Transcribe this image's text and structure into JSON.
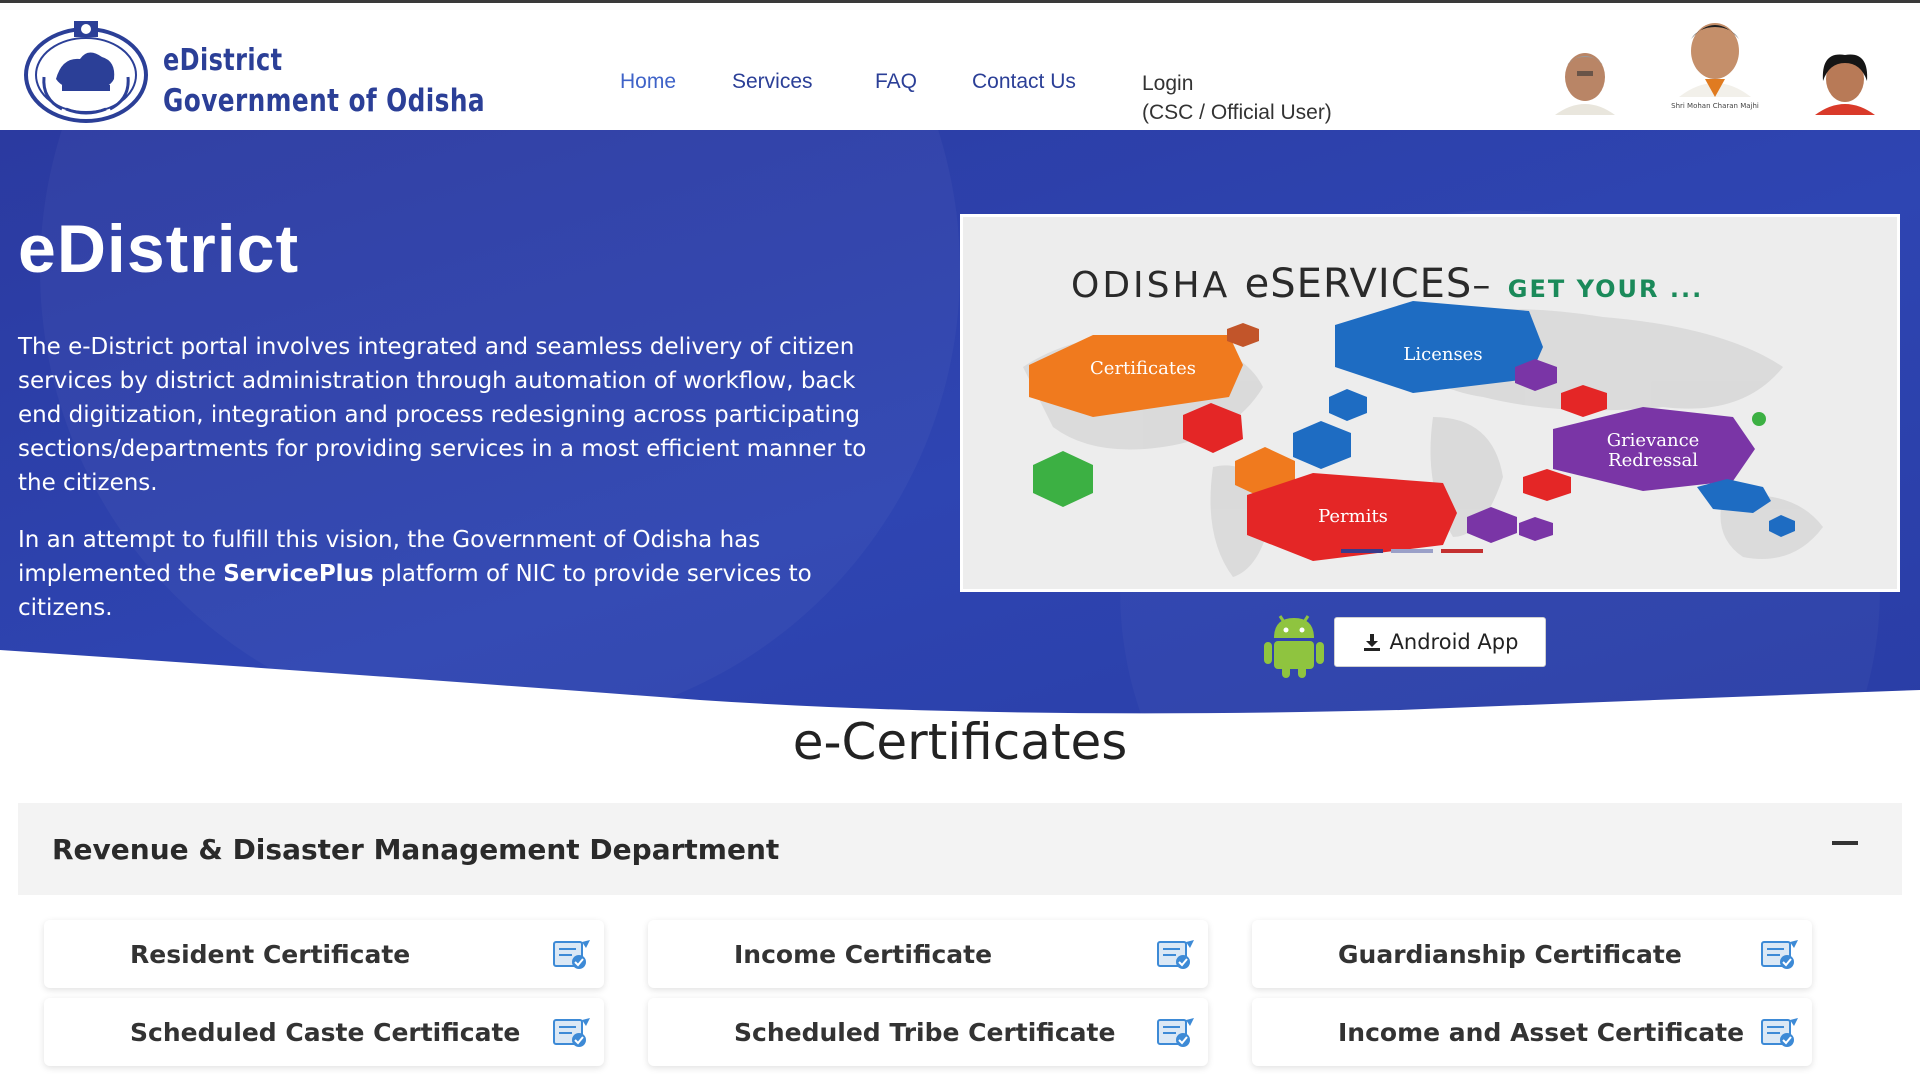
{
  "header": {
    "brand_line1": "eDistrict",
    "brand_line2": "Government of Odisha",
    "nav": {
      "home": "Home",
      "services": "Services",
      "faq": "FAQ",
      "contact": "Contact Us",
      "login_line1": "Login",
      "login_line2": "(CSC / Official User)"
    },
    "leaders": {
      "center_caption": "Shri Mohan Charan Majhi"
    }
  },
  "hero": {
    "title": "eDistrict",
    "paragraph1": "The e-District portal involves integrated and seamless delivery of citizen services by district administration through automation of workflow, back end digitization, integration and process redesigning across participating sections/departments for providing services in a most efficient manner to the citizens.",
    "paragraph2_before": "In an attempt to fulfill this vision, the Government of Odisha has implemented the ",
    "paragraph2_bold": "ServicePlus",
    "paragraph2_after": " platform of NIC to provide services to citizens.",
    "banner": {
      "title_part1": "ODISHA ",
      "title_part2": "eSERVICES",
      "title_part3": "– ",
      "title_part4": "GET YOUR ...",
      "hex_certificates": "Certificates",
      "hex_licenses": "Licenses",
      "hex_grievance_1": "Grievance",
      "hex_grievance_2": "Redressal",
      "hex_permits": "Permits"
    },
    "android_button": "Android App",
    "icons": {
      "download": "download-icon",
      "android": "android-icon"
    }
  },
  "ecertificates": {
    "title": "e-Certificates",
    "department": "Revenue & Disaster Management Department",
    "toggle": "−",
    "certificates": [
      "Resident Certificate",
      "Income Certificate",
      "Guardianship Certificate",
      "Scheduled Caste Certificate",
      "Scheduled Tribe Certificate",
      "Income and Asset Certificate"
    ]
  },
  "colors": {
    "brand_blue": "#2b3f97",
    "hero_blue": "#2f3fa6",
    "banner_green": "#1b8a5a",
    "hex_orange": "#f07a1e",
    "hex_blue": "#1e6cc2",
    "hex_purple": "#7a35a6",
    "hex_red": "#e42626"
  }
}
